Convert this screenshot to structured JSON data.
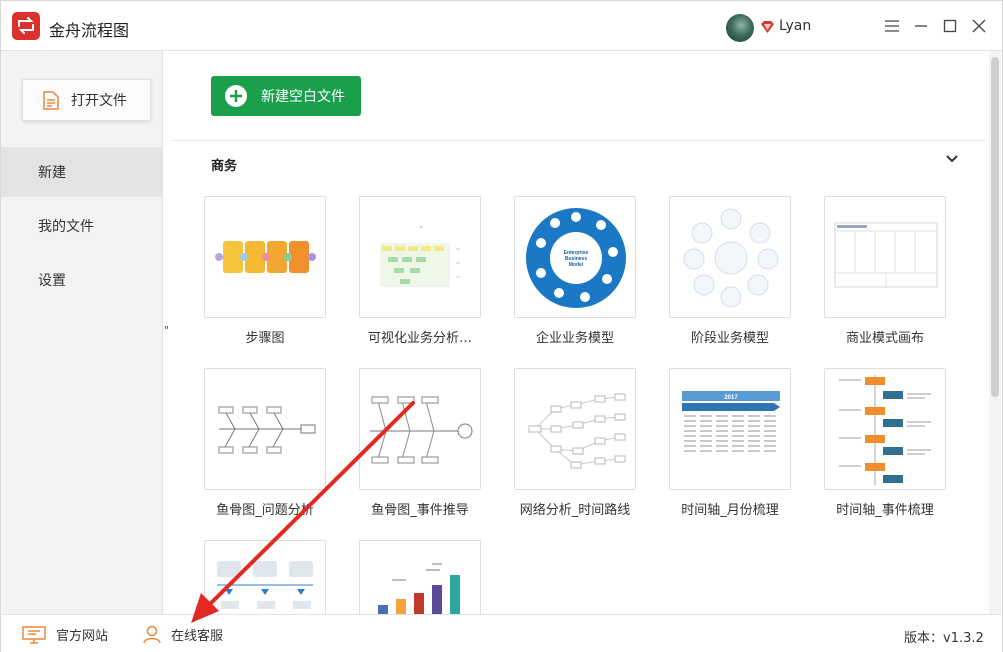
{
  "app": {
    "title": "金舟流程图",
    "logo_icon": "flowchart-logo-icon",
    "brand_color": "#d9312b"
  },
  "user": {
    "name": "Lyan",
    "badge_icon": "vip-diamond-icon"
  },
  "window_controls": {
    "menu": "menu-icon",
    "minimize": "minimize-icon",
    "maximize": "maximize-icon",
    "close": "close-icon"
  },
  "sidebar": {
    "open_file_label": "打开文件",
    "items": [
      {
        "label": "新建",
        "active": true
      },
      {
        "label": "我的文件",
        "active": false
      },
      {
        "label": "设置",
        "active": false
      }
    ]
  },
  "main": {
    "new_blank_label": "新建空白文件",
    "new_button_color": "#1aa04c",
    "section": {
      "title": "商务",
      "collapsed": false
    },
    "templates": [
      {
        "label": "步骤图"
      },
      {
        "label": "可视化业务分析…"
      },
      {
        "label": "企业业务模型",
        "thumb_text": [
          "Enterprise",
          "Business",
          "Model"
        ]
      },
      {
        "label": "阶段业务模型"
      },
      {
        "label": "商业模式画布"
      },
      {
        "label": "鱼骨图_问题分析"
      },
      {
        "label": "鱼骨图_事件推导"
      },
      {
        "label": "网络分析_时间路线"
      },
      {
        "label": "时间轴_月份梳理",
        "thumb_text": [
          "2017"
        ]
      },
      {
        "label": "时间轴_事件梳理"
      },
      {
        "label": ""
      },
      {
        "label": ""
      }
    ]
  },
  "statusbar": {
    "website_label": "官方网站",
    "support_label": "在线客服",
    "version": "版本：v1.3.2"
  }
}
